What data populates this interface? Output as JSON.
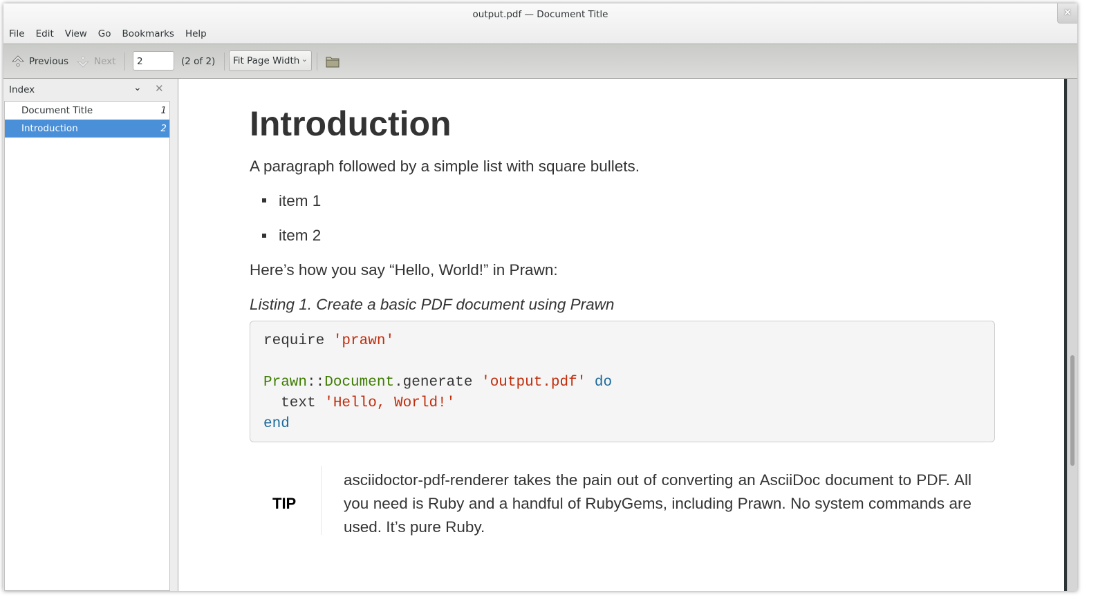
{
  "window": {
    "title": "output.pdf — Document Title",
    "close": "×"
  },
  "menu": [
    "File",
    "Edit",
    "View",
    "Go",
    "Bookmarks",
    "Help"
  ],
  "toolbar": {
    "previous": "Previous",
    "next": "Next",
    "page_value": "2",
    "page_count": "(2 of 2)",
    "zoom": "Fit Page Width"
  },
  "sidebar": {
    "title": "Index",
    "items": [
      {
        "label": "Document Title",
        "page": "1",
        "selected": false
      },
      {
        "label": "Introduction",
        "page": "2",
        "selected": true
      }
    ]
  },
  "document": {
    "heading": "Introduction",
    "para1": "A paragraph followed by a simple list with square bullets.",
    "items": [
      "item 1",
      "item 2"
    ],
    "para2": "Here’s how you say “Hello, World!” in Prawn:",
    "listing_title": "Listing 1. Create a basic PDF document using Prawn",
    "code": {
      "l1a": "require ",
      "l1b": "'prawn'",
      "l3a": "Prawn",
      "l3b": "::",
      "l3c": "Document",
      "l3d": ".generate ",
      "l3e": "'output.pdf'",
      "l3f": " do",
      "l4a": "  text ",
      "l4b": "'Hello, World!'",
      "l5": "end"
    },
    "tip_label": "TIP",
    "tip_text": "asciidoctor-pdf-renderer takes the pain out of converting an AsciiDoc document to PDF. All you need is Ruby and a handful of RubyGems, including Prawn. No system commands are used. It’s pure Ruby."
  }
}
